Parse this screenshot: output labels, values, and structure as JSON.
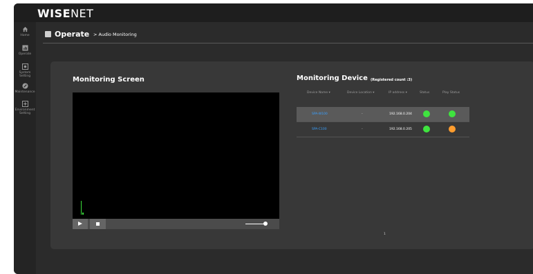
{
  "app": {
    "logo_bold": "WISE",
    "logo_thin": "NET"
  },
  "sidebar": {
    "items": [
      {
        "label": "Home",
        "icon": "home-icon"
      },
      {
        "label": "Operate",
        "icon": "operate-icon"
      },
      {
        "label": "System Setting",
        "icon": "system-setting-icon"
      },
      {
        "label": "Maintenance",
        "icon": "maintenance-icon"
      },
      {
        "label": "Environment Setting",
        "icon": "environment-setting-icon"
      }
    ]
  },
  "header": {
    "title": "Operate",
    "breadcrumb": "> Audio Monitoring"
  },
  "monitoring_screen": {
    "title": "Monitoring Screen",
    "volume_level": 0.9
  },
  "monitoring_device": {
    "title": "Monitoring Device",
    "registered_count": "(Registered count :3)",
    "columns": [
      "Device Name",
      "Device Location",
      "IP address",
      "Status",
      "Play Status"
    ],
    "rows": [
      {
        "name": "SPA-W100",
        "location": "-",
        "ip": "192.168.0.204",
        "status_color": "#3fe33f",
        "play_color": "#3fe33f"
      },
      {
        "name": "SPA-C100",
        "location": "-",
        "ip": "192.168.0.205",
        "status_color": "#3fe33f",
        "play_color": "#ff9d2e"
      }
    ],
    "page": "1"
  }
}
